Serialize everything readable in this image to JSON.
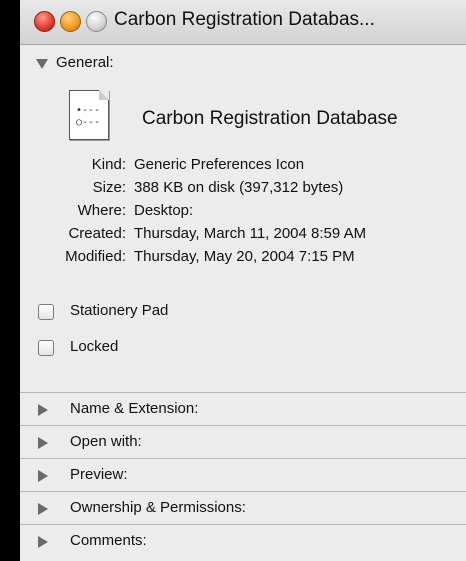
{
  "window": {
    "title": "Carbon Registration Databas..."
  },
  "general": {
    "label": "General:",
    "file_name": "Carbon Registration Database",
    "icon_lines": [
      "•---",
      "○---"
    ],
    "info": [
      {
        "key": "Kind:",
        "value": "Generic Preferences Icon"
      },
      {
        "key": "Size:",
        "value": "388 KB on disk (397,312 bytes)"
      },
      {
        "key": "Where:",
        "value": "Desktop:"
      },
      {
        "key": "Created:",
        "value": "Thursday, March 11, 2004 8:59 AM"
      },
      {
        "key": "Modified:",
        "value": "Thursday, May 20, 2004 7:15 PM"
      }
    ],
    "checkboxes": [
      {
        "label": "Stationery Pad",
        "checked": false
      },
      {
        "label": "Locked",
        "checked": false
      }
    ]
  },
  "sections": [
    {
      "label": "Name & Extension:",
      "expanded": false
    },
    {
      "label": "Open with:",
      "expanded": false
    },
    {
      "label": "Preview:",
      "expanded": false
    },
    {
      "label": "Ownership & Permissions:",
      "expanded": false
    },
    {
      "label": "Comments:",
      "expanded": false
    }
  ]
}
